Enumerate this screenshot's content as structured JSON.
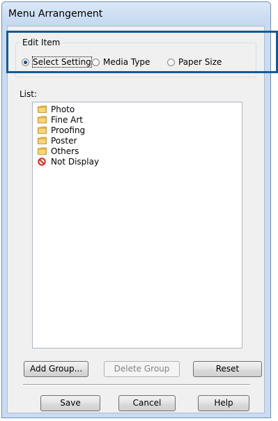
{
  "window": {
    "title": "Menu Arrangement"
  },
  "edit_item": {
    "legend": "Edit Item",
    "options": [
      {
        "label": "Select Setting",
        "checked": true
      },
      {
        "label": "Media Type",
        "checked": false
      },
      {
        "label": "Paper Size",
        "checked": false
      }
    ]
  },
  "list": {
    "label": "List:",
    "items": [
      {
        "label": "Photo",
        "icon": "folder-icon"
      },
      {
        "label": "Fine Art",
        "icon": "folder-icon"
      },
      {
        "label": "Proofing",
        "icon": "folder-icon"
      },
      {
        "label": "Poster",
        "icon": "folder-icon"
      },
      {
        "label": "Others",
        "icon": "folder-icon"
      },
      {
        "label": "Not Display",
        "icon": "prohibited-icon"
      }
    ]
  },
  "buttons": {
    "add_group": "Add Group...",
    "delete_group": "Delete Group",
    "reset": "Reset",
    "save": "Save",
    "cancel": "Cancel",
    "help": "Help"
  },
  "colors": {
    "highlight_border": "#145a96",
    "window_frame": "#c9dcf2",
    "dialog_background": "#f0f0f0"
  }
}
